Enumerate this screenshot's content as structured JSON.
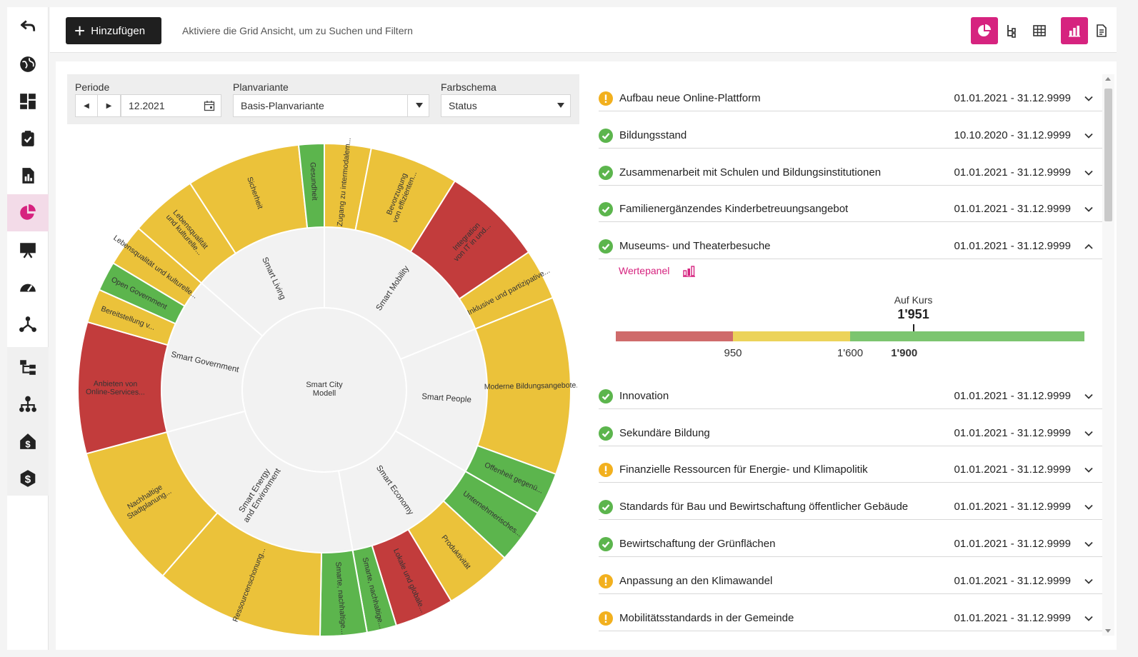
{
  "toolbar": {
    "add_label": "Hinzufügen",
    "hint": "Aktiviere die Grid Ansicht, um zu Suchen und Filtern",
    "accent": "#d6237f"
  },
  "sidebar": {
    "icons": [
      "back-arrow-icon",
      "globe-icon",
      "dashboard-icon",
      "clipboard-check-icon",
      "report-chart-icon",
      "pie-chart-icon",
      "presentation-icon",
      "gauge-icon",
      "network-icon",
      "hierarchy-icon",
      "org-chart-icon",
      "house-dollar-icon",
      "dollar-circle-icon"
    ]
  },
  "filters": {
    "periode_label": "Periode",
    "periode_value": "12.2021",
    "plan_label": "Planvariante",
    "plan_value": "Basis-Planvariante",
    "farb_label": "Farbschema",
    "farb_value": "Status"
  },
  "sunburst": {
    "center": "Smart City\nModell",
    "colors": {
      "green": "#5cb54d",
      "yellow": "#ebc23a",
      "red": "#c23c3c",
      "ring": "#f2f2f2"
    },
    "sectors": [
      {
        "name": "Smart Living",
        "start": -49,
        "end": 0,
        "leaves": [
          {
            "label": "Lebensqualität und kulturelle...",
            "start": -49,
            "end": -33,
            "status": "yellow"
          },
          {
            "label": "Sicherheit",
            "start": -33,
            "end": -6,
            "status": "yellow"
          },
          {
            "label": "Gesundheit",
            "start": -6,
            "end": 0,
            "status": "green"
          }
        ]
      },
      {
        "name": "Smart Mobility",
        "start": 0,
        "end": 68,
        "leaves": [
          {
            "label": "Zugang zu intermodalem...",
            "start": 0,
            "end": 11,
            "status": "yellow"
          },
          {
            "label": "Bevorzugung von effizienten...",
            "start": 11,
            "end": 32,
            "status": "yellow"
          },
          {
            "label": "Integration von IT in und...",
            "start": 32,
            "end": 56,
            "status": "red"
          },
          {
            "label": "Inklusive und partizipative...",
            "start": 56,
            "end": 68,
            "status": "yellow"
          }
        ]
      },
      {
        "name": "Smart People",
        "start": 68,
        "end": 120,
        "leaves": [
          {
            "label": "Moderne Bildungsangebote...",
            "start": 68,
            "end": 110,
            "status": "yellow"
          },
          {
            "label": "Offenheit gegenü...",
            "start": 110,
            "end": 120,
            "status": "green"
          }
        ]
      },
      {
        "name": "Smart Economy",
        "start": 120,
        "end": 170,
        "leaves": [
          {
            "label": "Unternehmerisches...",
            "start": 120,
            "end": 133,
            "status": "green"
          },
          {
            "label": "Produktivität",
            "start": 133,
            "end": 149,
            "status": "yellow"
          },
          {
            "label": "Lokale und globale...",
            "start": 149,
            "end": 163,
            "status": "red"
          },
          {
            "label": "Smarte, nachhaltige...",
            "start": 163,
            "end": 170,
            "status": "green"
          }
        ]
      },
      {
        "name": "Smart Energy and Environment",
        "start": 170,
        "end": 255,
        "leaves": [
          {
            "label": "Smarte, nachhaltige...",
            "start": 170,
            "end": 181,
            "status": "green"
          },
          {
            "label": "Ressourcenschonung...",
            "start": 181,
            "end": 221,
            "status": "yellow"
          },
          {
            "label": "Nachhaltige Stadtplanung...",
            "start": 221,
            "end": 255,
            "status": "yellow"
          }
        ]
      },
      {
        "name": "Smart Government",
        "start": 255,
        "end": 311,
        "leaves": [
          {
            "label": "Anbieten von Online-Services...",
            "start": 255,
            "end": 286,
            "status": "red"
          },
          {
            "label": "Bereitstellung v...",
            "start": 286,
            "end": 294,
            "status": "yellow"
          },
          {
            "label": "Open Government",
            "start": 294,
            "end": 301,
            "status": "green"
          },
          {
            "label": "Lebensqualität und kulturelle...",
            "start": 301,
            "end": 311,
            "status": "yellow"
          }
        ]
      }
    ]
  },
  "list": {
    "items": [
      {
        "label": "Aufbau neue Online-Plattform",
        "date": "01.01.2021 - 31.12.9999",
        "status": "warn"
      },
      {
        "label": "Bildungsstand",
        "date": "10.10.2020 - 31.12.9999",
        "status": "ok"
      },
      {
        "label": "Zusammenarbeit mit Schulen und Bildungsinstitutionen",
        "date": "01.01.2021 - 31.12.9999",
        "status": "ok"
      },
      {
        "label": "Familienergänzendes Kinderbetreuungsangebot",
        "date": "01.01.2021 - 31.12.9999",
        "status": "ok"
      },
      {
        "label": "Museums- und Theaterbesuche",
        "date": "01.01.2021 - 31.12.9999",
        "status": "ok",
        "expanded": true
      },
      {
        "label": "Innovation",
        "date": "01.01.2021 - 31.12.9999",
        "status": "ok"
      },
      {
        "label": "Sekundäre Bildung",
        "date": "01.01.2021 - 31.12.9999",
        "status": "ok"
      },
      {
        "label": "Finanzielle Ressourcen für Energie- und Klimapolitik",
        "date": "01.01.2021 - 31.12.9999",
        "status": "warn"
      },
      {
        "label": "Standards für Bau und Bewirtschaftung öffentlicher Gebäude",
        "date": "01.01.2021 - 31.12.9999",
        "status": "ok"
      },
      {
        "label": "Bewirtschaftung der Grünflächen",
        "date": "01.01.2021 - 31.12.9999",
        "status": "ok"
      },
      {
        "label": "Anpassung an den Klimawandel",
        "date": "01.01.2021 - 31.12.9999",
        "status": "warn"
      },
      {
        "label": "Mobilitätsstandards in der Gemeinde",
        "date": "01.01.2021 - 31.12.9999",
        "status": "warn"
      }
    ],
    "status_colors": {
      "ok": "#5cb54d",
      "warn": "#f2b01e"
    }
  },
  "wertepanel": {
    "label": "Wertepanel",
    "status_text": "Auf Kurs",
    "current": "1'951",
    "tick_950": "950",
    "tick_1600": "1'600",
    "tick_1900": "1'900",
    "gauge": {
      "min": 300,
      "max": 2900,
      "red_to": 950,
      "yellow_to": 1600,
      "current_value": 1951,
      "target_value": 1900
    },
    "colors": {
      "red": "#cf6b6b",
      "yellow": "#ecd35a",
      "green": "#7cc56f"
    }
  }
}
